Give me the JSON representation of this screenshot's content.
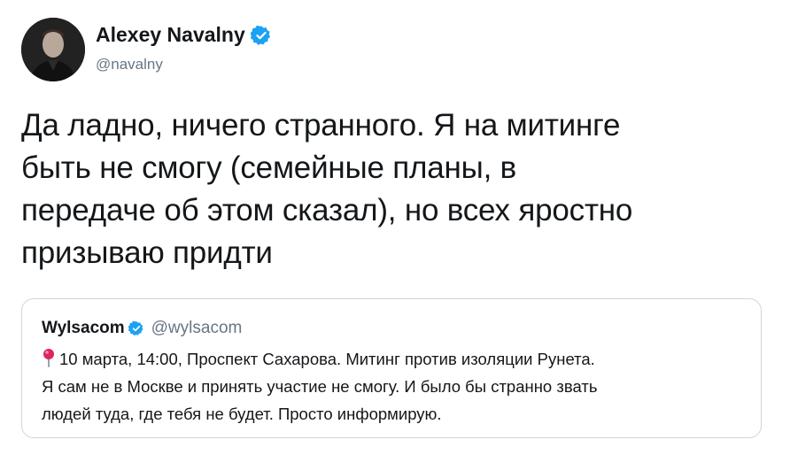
{
  "tweet": {
    "author_name": "Alexey Navalny",
    "author_handle": "@navalny",
    "avatar_icon": "profile-photo",
    "verified_icon": "verified-badge-icon",
    "verified_color": "#1da1f2",
    "text_lines": [
      "Да ладно, ничего странного. Я на митинге",
      "быть не смогу (семейные планы, в",
      "передаче об этом сказал), но всех яростно",
      "призываю придти"
    ]
  },
  "quote": {
    "author_name": "Wylsacom",
    "author_handle": "@wylsacom",
    "pin_icon": "round-pushpin-icon",
    "text_lines": [
      "10 марта, 14:00, Проспект Сахарова. Митинг против изоляции Рунета.",
      "Я сам не в Москве и принять участие не смогу. И было бы странно звать",
      "людей туда, где тебя не будет. Просто информирую."
    ]
  },
  "colors": {
    "text": "#14171a",
    "secondary": "#657786",
    "border": "#ccd6dd",
    "verified": "#1da1f2",
    "pin": "#e0245e"
  }
}
